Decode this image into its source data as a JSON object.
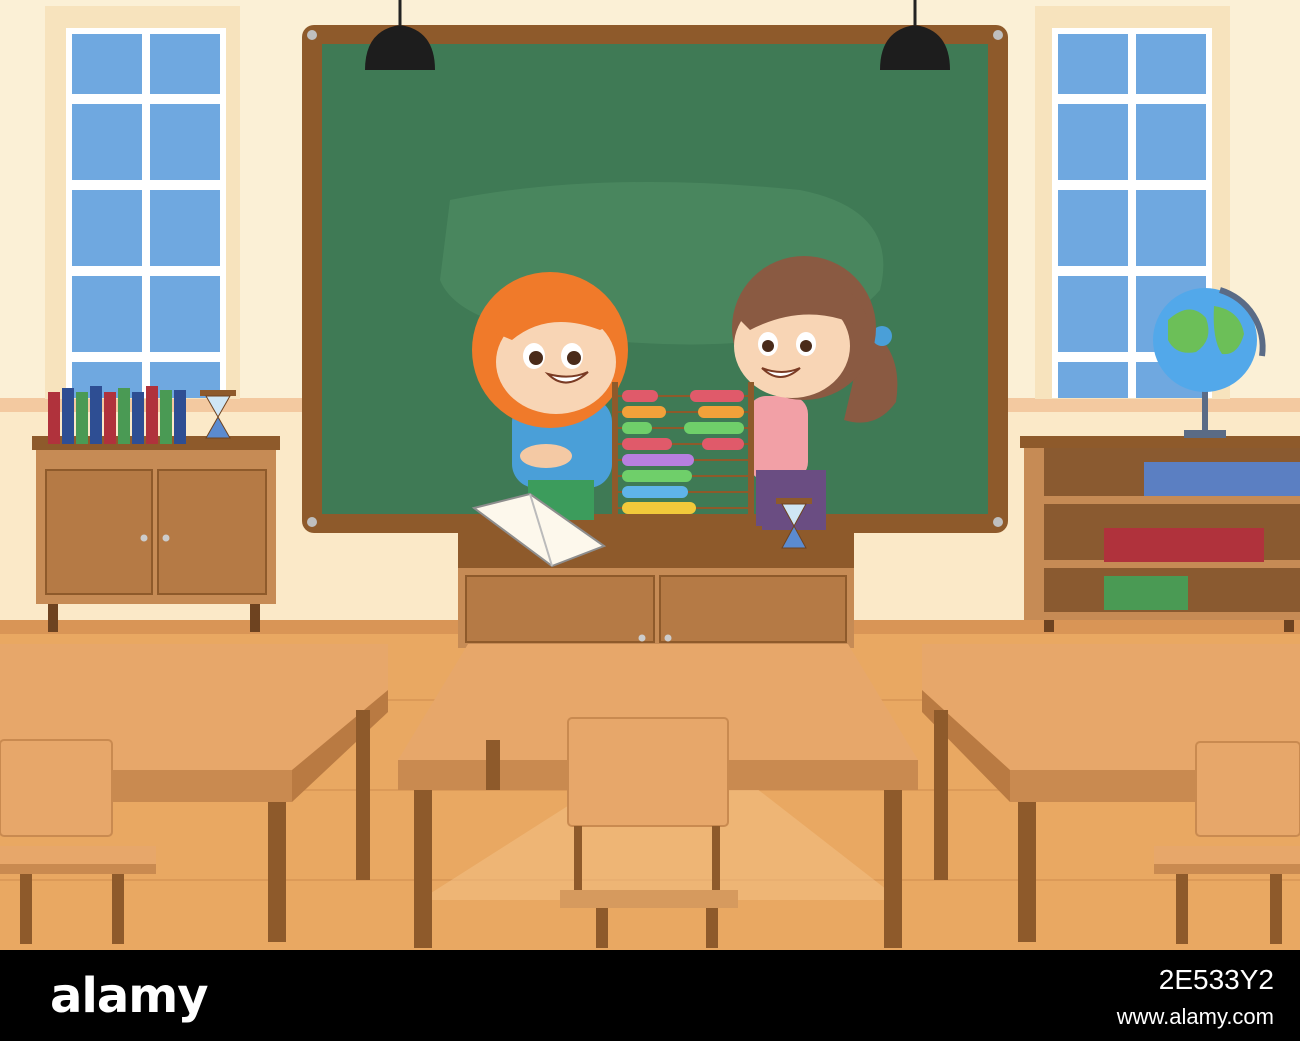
{
  "watermark": {
    "logo_text": "alamy",
    "image_id": "2E533Y2",
    "url": "www.alamy.com",
    "overlay_text": "alamy"
  },
  "colors": {
    "wall": "#fbf0d6",
    "floor": "#e9a862",
    "chalkboard": "#3f7a55",
    "frame": "#8e5a2b",
    "desk_top": "#e7a76a",
    "window_glass": "#6fa8e0",
    "hair_boy": "#f07a2a",
    "hair_girl": "#8a5a42"
  },
  "scene": {
    "icons": [
      "chalkboard",
      "window",
      "pendant-lamp",
      "abacus",
      "globe",
      "hourglass",
      "book",
      "desk",
      "chair",
      "bookshelf",
      "cabinet"
    ]
  }
}
